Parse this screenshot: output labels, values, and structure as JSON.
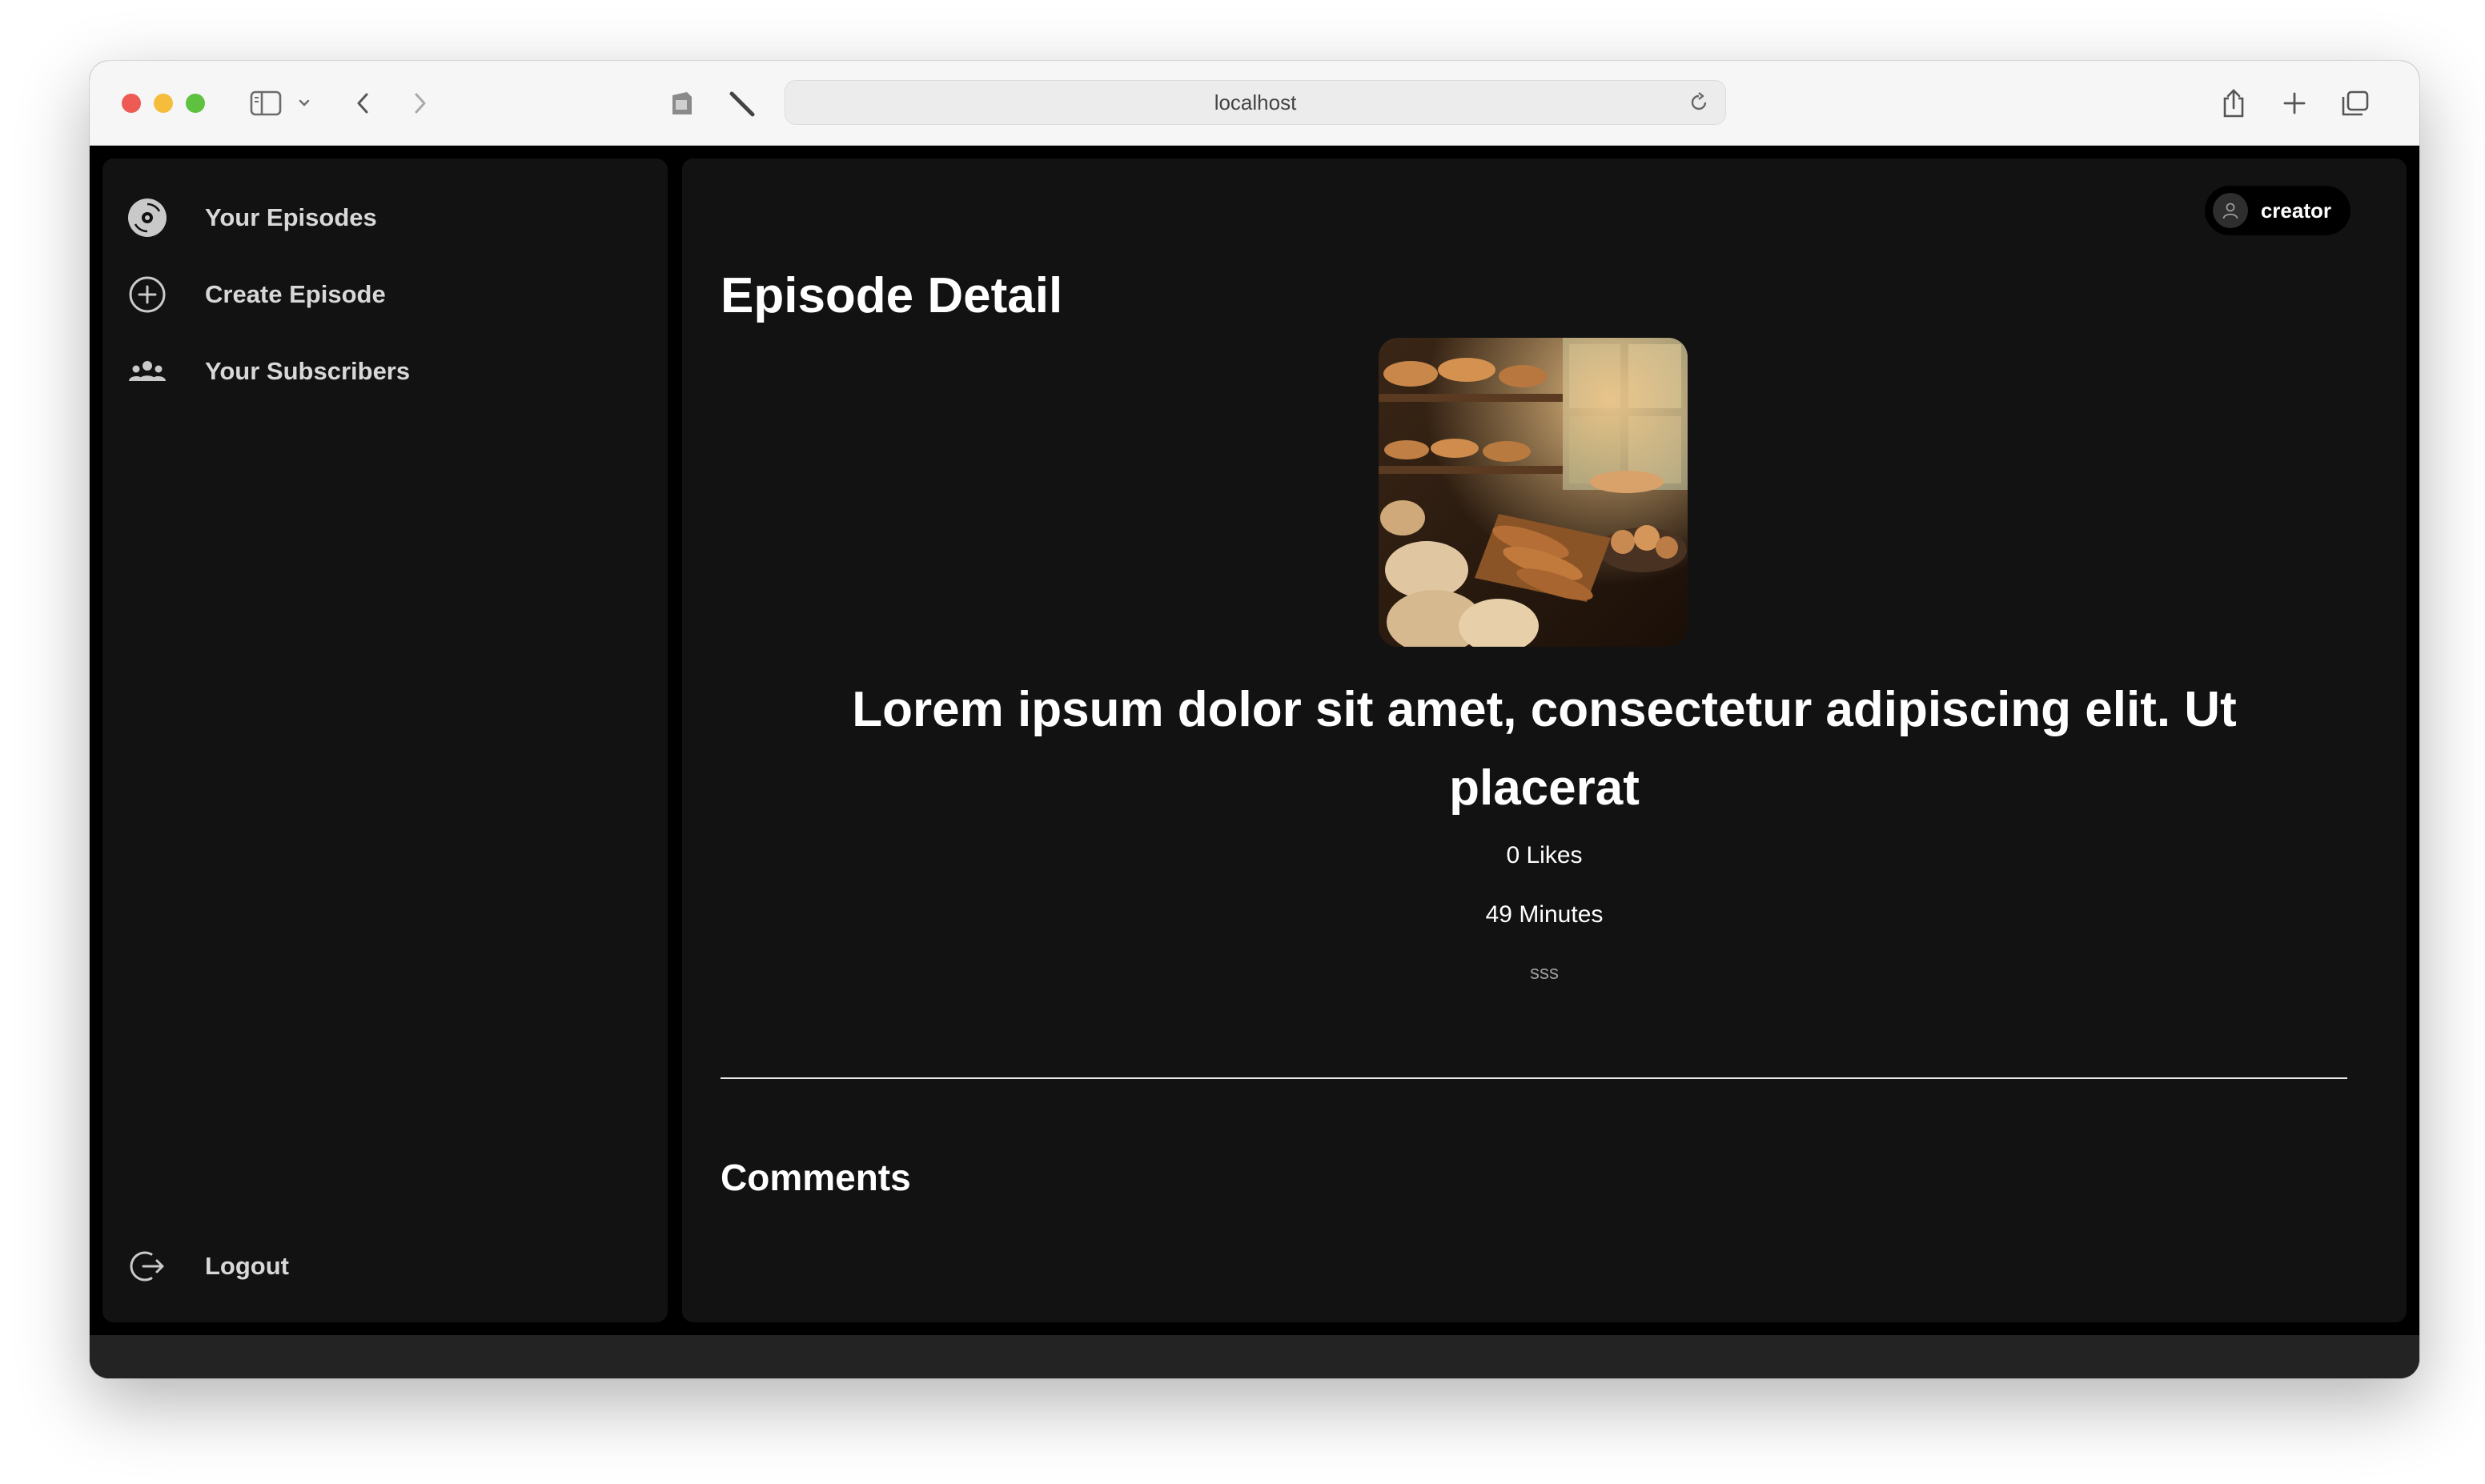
{
  "browser": {
    "url": "localhost"
  },
  "sidebar": {
    "items": [
      {
        "label": "Your Episodes",
        "icon": "disc-icon"
      },
      {
        "label": "Create Episode",
        "icon": "plus-circle-icon"
      },
      {
        "label": "Your Subscribers",
        "icon": "users-icon"
      }
    ],
    "logout": {
      "label": "Logout",
      "icon": "logout-icon"
    }
  },
  "header": {
    "user_name": "creator"
  },
  "episode": {
    "page_title": "Episode Detail",
    "title": "Lorem ipsum dolor sit amet, consectetur adipiscing elit. Ut placerat",
    "likes": "0 Likes",
    "duration": "49 Minutes",
    "description": "sss",
    "cover_alt": "bakery-bread-image"
  },
  "comments": {
    "title": "Comments"
  },
  "colors": {
    "background": "#000000",
    "panel": "#121212",
    "text": "#ffffff",
    "muted": "#9a9a9a"
  }
}
